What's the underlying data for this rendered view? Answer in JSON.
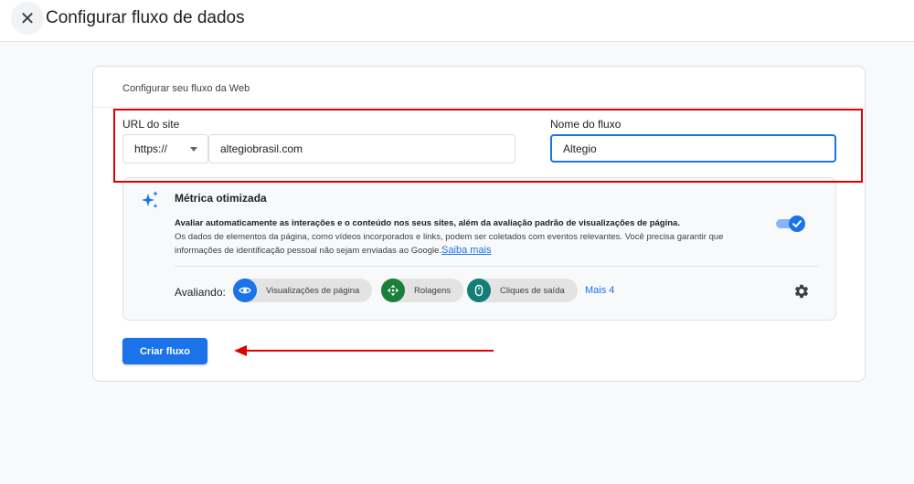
{
  "header": {
    "title": "Configurar fluxo de dados",
    "close_icon": "close-icon"
  },
  "card": {
    "heading": "Configurar seu fluxo da Web"
  },
  "url_field": {
    "label": "URL do site",
    "protocol": "https://",
    "value": "altegiobrasil.com"
  },
  "name_field": {
    "label": "Nome do fluxo",
    "value": "Altegio"
  },
  "metric": {
    "title": "Métrica otimizada",
    "desc_bold": "Avaliar automaticamente as interações e o conteúdo nos seus sites, além da avaliação padrão de visualizações de página.",
    "desc_text": "Os dados de elementos da página, como vídeos incorporados e links, podem ser coletados com eventos relevantes. Você precisa garantir que informações de identificação pessoal não sejam enviadas ao Google.",
    "learn_more": "Saiba mais",
    "toggle_on": true,
    "evaluating_label": "Avaliando:",
    "chips": [
      {
        "label": "Visualizações de página",
        "icon": "eye-icon",
        "color": "#1a73e8"
      },
      {
        "label": "Rolagens",
        "icon": "scroll-icon",
        "color": "#188038"
      },
      {
        "label": "Cliques de saída",
        "icon": "mouse-icon",
        "color": "#137d78"
      }
    ],
    "more": "Mais 4",
    "settings_icon": "gear-icon"
  },
  "actions": {
    "create_label": "Criar fluxo"
  },
  "colors": {
    "accent": "#1a73e8",
    "annotation": "#e00000"
  }
}
